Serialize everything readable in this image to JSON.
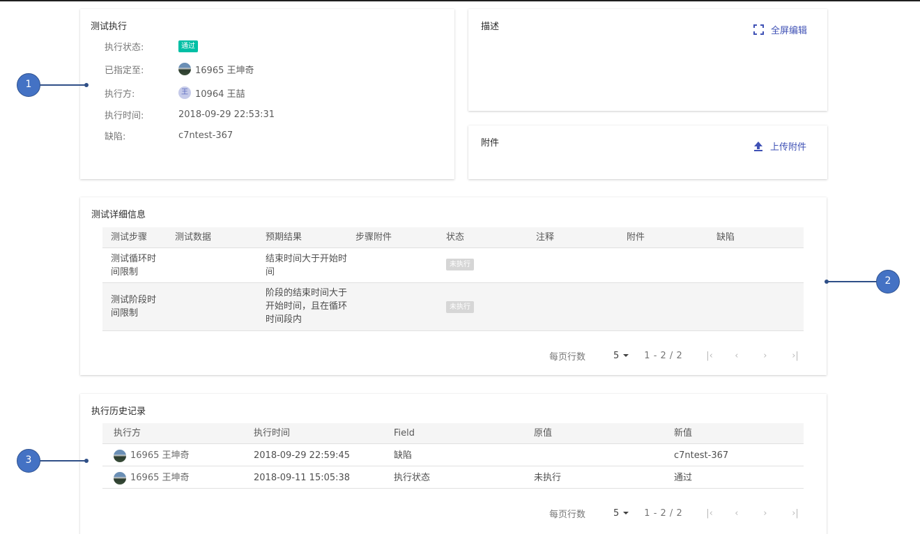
{
  "execution": {
    "title": "测试执行",
    "status_label": "执行状态:",
    "status_value": "通过",
    "status_color": "#00bfa5",
    "assigned_label": "已指定至:",
    "assigned_value": "16965 王坤奇",
    "executor_label": "执行方:",
    "executor_avatar_char": "王",
    "executor_value": "10964 王喆",
    "time_label": "执行时间:",
    "time_value": "2018-09-29 22:53:31",
    "defect_label": "缺陷:",
    "defect_value": "c7ntest-367"
  },
  "description": {
    "title": "描述",
    "action_label": "全屏编辑",
    "action_icon": "fullscreen-icon"
  },
  "attachments": {
    "title": "附件",
    "action_label": "上传附件",
    "action_icon": "upload-icon"
  },
  "details": {
    "title": "测试详细信息",
    "columns": [
      "测试步骤",
      "测试数据",
      "预期结果",
      "步骤附件",
      "状态",
      "注释",
      "附件",
      "缺陷"
    ],
    "rows": [
      {
        "step_lines": [
          "测试循环时",
          "间限制"
        ],
        "data": "",
        "expected_lines": [
          "结束时间大于开始时",
          "间"
        ],
        "step_attachment": "",
        "status": "未执行",
        "comment": "",
        "attachment": "",
        "defect": ""
      },
      {
        "step_lines": [
          "测试阶段时",
          "间限制"
        ],
        "data": "",
        "expected_lines": [
          "阶段的结束时间大于",
          "开始时间，且在循环",
          "时间段内"
        ],
        "step_attachment": "",
        "status": "未执行",
        "comment": "",
        "attachment": "",
        "defect": ""
      }
    ],
    "pager": {
      "rows_per_page_label": "每页行数",
      "page_size": "5",
      "range": "1 - 2 / 2",
      "first": "|‹",
      "prev": "‹",
      "next": "›",
      "last": "›|"
    }
  },
  "history": {
    "title": "执行历史记录",
    "columns": [
      "执行方",
      "执行时间",
      "Field",
      "原值",
      "新值"
    ],
    "rows": [
      {
        "user": "16965 王坤奇",
        "time": "2018-09-29 22:59:45",
        "field": "缺陷",
        "old": "",
        "new": "c7ntest-367"
      },
      {
        "user": "16965 王坤奇",
        "time": "2018-09-11 15:05:38",
        "field": "执行状态",
        "old": "未执行",
        "new": "通过"
      }
    ],
    "pager": {
      "rows_per_page_label": "每页行数",
      "page_size": "5",
      "range": "1 - 2 / 2",
      "first": "|‹",
      "prev": "‹",
      "next": "›",
      "last": "›|"
    }
  },
  "callouts": [
    "1",
    "2",
    "3"
  ],
  "colors": {
    "accent": "#3f51b5",
    "callout": "#4472c4",
    "not_run_badge": "#d6d6d6"
  }
}
